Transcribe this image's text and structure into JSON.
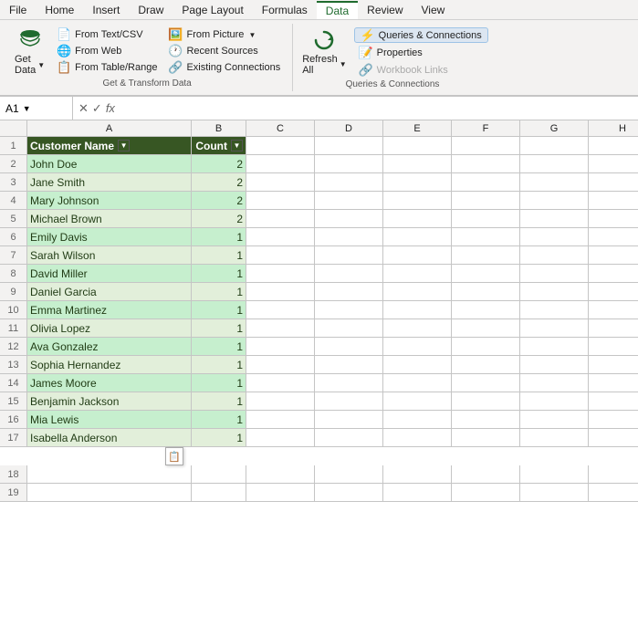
{
  "menu": {
    "items": [
      {
        "label": "File"
      },
      {
        "label": "Home"
      },
      {
        "label": "Insert"
      },
      {
        "label": "Draw"
      },
      {
        "label": "Page Layout"
      },
      {
        "label": "Formulas"
      },
      {
        "label": "Data"
      },
      {
        "label": "Review"
      },
      {
        "label": "View"
      }
    ],
    "active": "Data"
  },
  "ribbon": {
    "get_data_btn": "Get\nData",
    "get_data_dropdown": "▼",
    "from_text_csv": "From Text/CSV",
    "from_web": "From Web",
    "from_table_range": "From Table/Range",
    "from_picture": "From Picture",
    "from_picture_dropdown": "▼",
    "recent_sources": "Recent Sources",
    "existing_connections": "Existing Connections",
    "refresh_all": "Refresh\nAll",
    "refresh_all_dropdown": "▼",
    "queries_connections": "Queries & Connections",
    "properties": "Properties",
    "workbook_links": "Workbook Links",
    "group1_title": "Get & Transform Data",
    "group2_title": "Queries & Connections"
  },
  "formula_bar": {
    "cell_ref": "A1",
    "formula": ""
  },
  "columns": [
    "A",
    "B",
    "C",
    "D",
    "E",
    "F",
    "G",
    "H"
  ],
  "headers": {
    "col_a": "Customer Name",
    "col_b": "Count"
  },
  "rows": [
    {
      "num": 2,
      "name": "John Doe",
      "count": "2"
    },
    {
      "num": 3,
      "name": "Jane Smith",
      "count": "2"
    },
    {
      "num": 4,
      "name": "Mary Johnson",
      "count": "2"
    },
    {
      "num": 5,
      "name": "Michael Brown",
      "count": "2"
    },
    {
      "num": 6,
      "name": "Emily Davis",
      "count": "1"
    },
    {
      "num": 7,
      "name": "Sarah Wilson",
      "count": "1"
    },
    {
      "num": 8,
      "name": "David Miller",
      "count": "1"
    },
    {
      "num": 9,
      "name": "Daniel Garcia",
      "count": "1"
    },
    {
      "num": 10,
      "name": "Emma Martinez",
      "count": "1"
    },
    {
      "num": 11,
      "name": "Olivia Lopez",
      "count": "1"
    },
    {
      "num": 12,
      "name": "Ava Gonzalez",
      "count": "1"
    },
    {
      "num": 13,
      "name": "Sophia Hernandez",
      "count": "1"
    },
    {
      "num": 14,
      "name": "James Moore",
      "count": "1"
    },
    {
      "num": 15,
      "name": "Benjamin Jackson",
      "count": "1"
    },
    {
      "num": 16,
      "name": "Mia Lewis",
      "count": "1"
    },
    {
      "num": 17,
      "name": "Isabella Anderson",
      "count": "1"
    }
  ],
  "empty_rows": [
    18,
    19
  ]
}
